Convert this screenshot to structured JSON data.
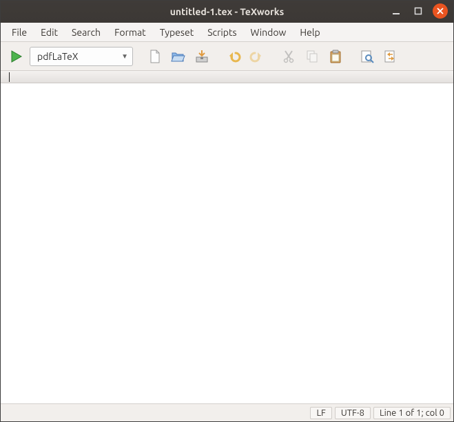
{
  "window_title": "untitled-1.tex - TeXworks",
  "menus": [
    "File",
    "Edit",
    "Search",
    "Format",
    "Typeset",
    "Scripts",
    "Window",
    "Help"
  ],
  "typeset_engine": "pdfLaTeX",
  "status": {
    "line_ending": "LF",
    "encoding": "UTF-8",
    "position": "Line 1 of 1; col 0"
  }
}
